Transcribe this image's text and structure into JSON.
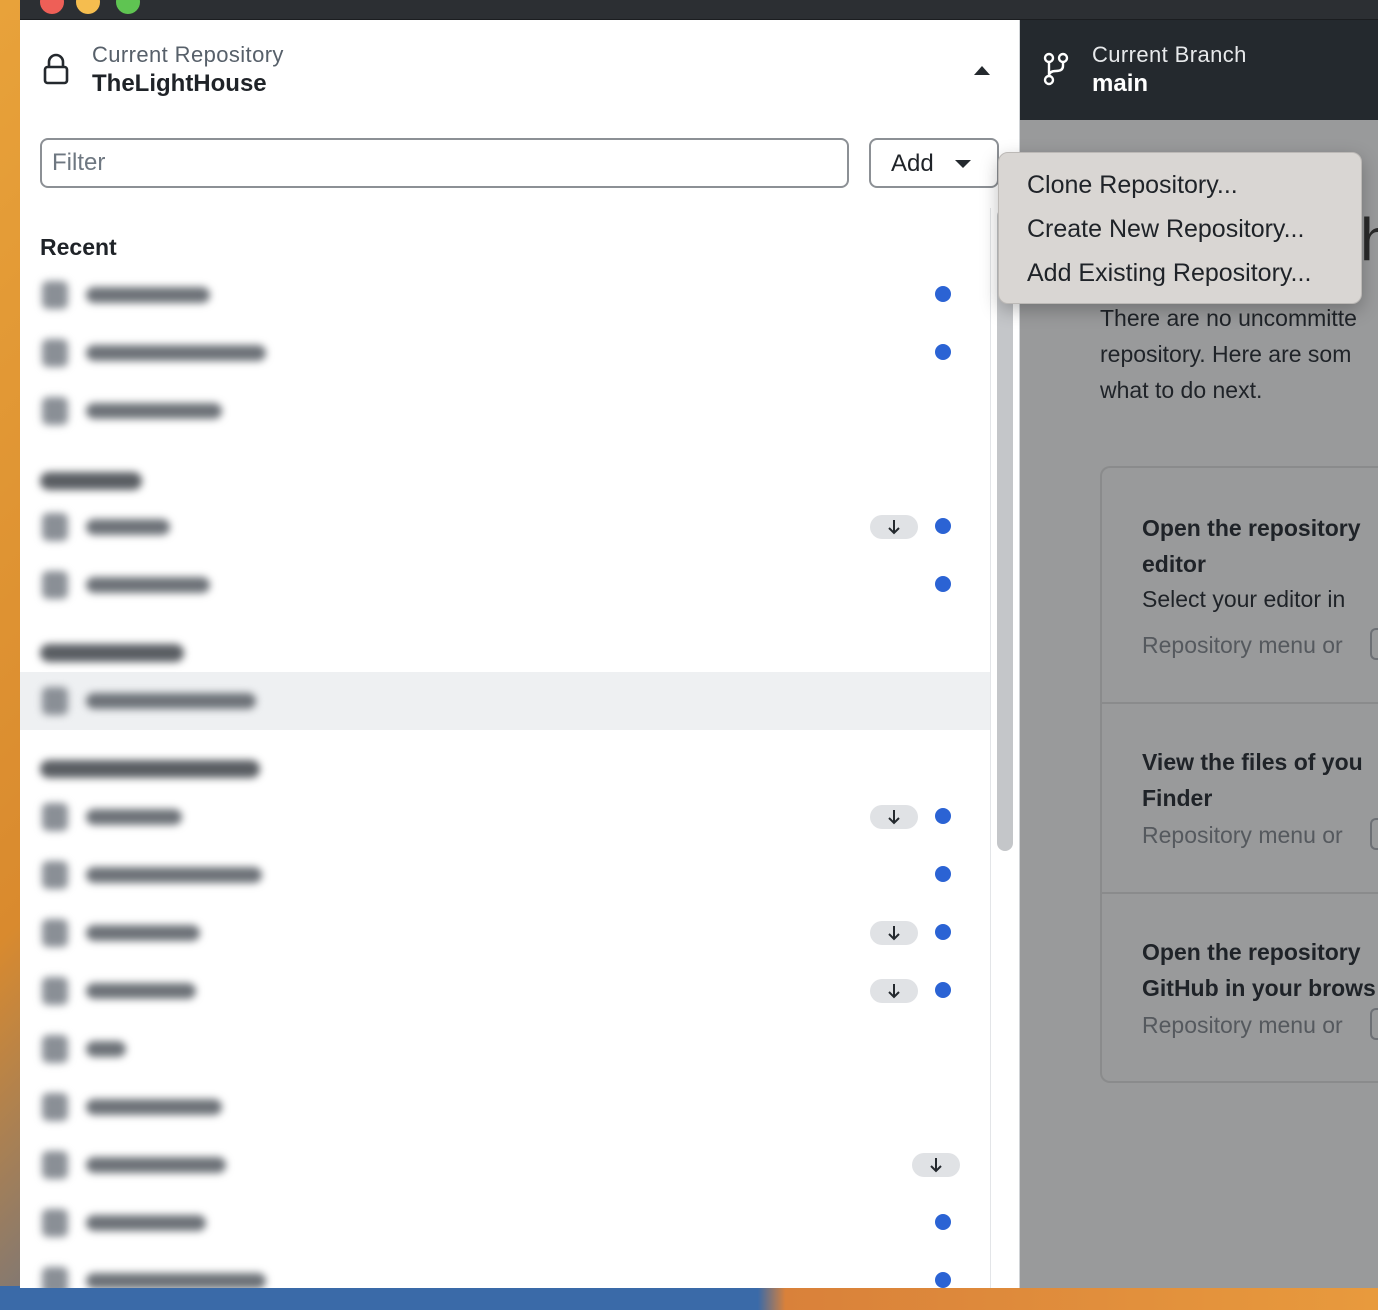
{
  "repository": {
    "label": "Current Repository",
    "name": "TheLightHouse"
  },
  "branch": {
    "label": "Current Branch",
    "name": "main"
  },
  "filter": {
    "placeholder": "Filter"
  },
  "add_button": {
    "label": "Add"
  },
  "add_menu": {
    "items": [
      {
        "label": "Clone Repository..."
      },
      {
        "label": "Create New Repository..."
      },
      {
        "label": "Add Existing Repository..."
      }
    ]
  },
  "list": {
    "recent_heading": "Recent"
  },
  "main": {
    "heading_fragment": "h",
    "intro_lines": [
      "There are no uncommitte",
      "repository. Here are som",
      "what to do next."
    ],
    "cards": [
      {
        "title_lines": [
          "Open the repository",
          "editor"
        ],
        "description": "Select your editor in",
        "hint": "Repository menu or"
      },
      {
        "title_lines": [
          "View the files of you",
          "Finder"
        ],
        "hint": "Repository menu or"
      },
      {
        "title_lines": [
          "Open the repository",
          "GitHub in your brows"
        ],
        "hint": "Repository menu or"
      }
    ]
  },
  "colors": {
    "accent_dot": "#2b63d4",
    "branch_bar": "#24292e"
  }
}
